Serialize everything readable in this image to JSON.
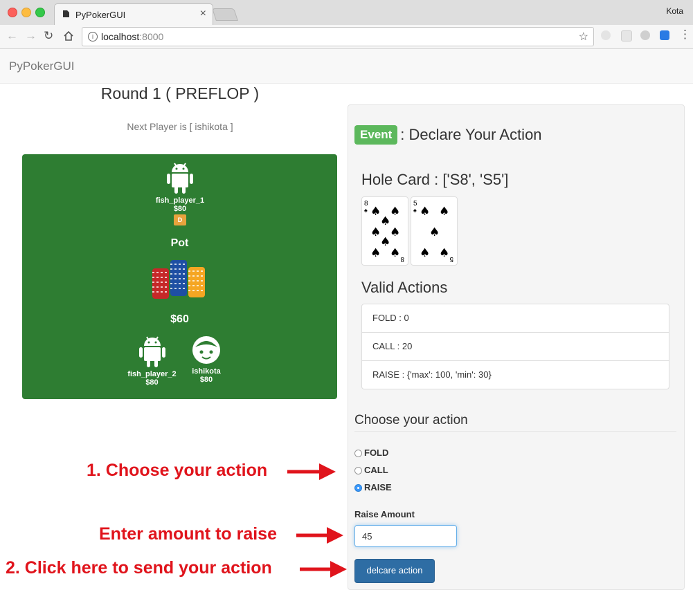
{
  "browser": {
    "tab_title": "PyPokerGUI",
    "profile_name": "Kota",
    "url_host": "localhost",
    "url_port": ":8000"
  },
  "navbar": {
    "brand": "PyPokerGUI"
  },
  "game": {
    "round_title": "Round 1 ( PREFLOP )",
    "next_player": "Next Player is [ ishikota ]",
    "players": [
      {
        "name": "fish_player_1",
        "stack": "$80",
        "dealer_badge": "D",
        "avatar_icon": "android-icon"
      },
      {
        "name": "fish_player_2",
        "stack": "$80",
        "avatar_icon": "android-icon"
      },
      {
        "name": "ishikota",
        "stack": "$80",
        "avatar_icon": "face-icon"
      }
    ],
    "pot_label": "Pot",
    "pot_amount": "$60",
    "table_color": "#2e7d32"
  },
  "panel": {
    "event_badge": "Event",
    "event_title": ": Declare Your Action",
    "hole_card_title": "Hole Card : ['S8', 'S5']",
    "cards": [
      {
        "rank": "8",
        "suit": "♠"
      },
      {
        "rank": "5",
        "suit": "♠"
      }
    ],
    "valid_actions_title": "Valid Actions",
    "valid_actions": [
      "FOLD : 0",
      "CALL : 20",
      "RAISE : {'max': 100, 'min': 30}"
    ],
    "choose_title": "Choose your action",
    "options": [
      {
        "label": "FOLD",
        "checked": false
      },
      {
        "label": "CALL",
        "checked": false
      },
      {
        "label": "RAISE",
        "checked": true
      }
    ],
    "raise_label": "Raise Amount",
    "raise_value": "45",
    "submit_label": "delcare action"
  },
  "annotations": {
    "step1": "1. Choose your action",
    "enter_amount": "Enter amount to raise",
    "step2": "2. Click here to send your action",
    "color": "#e0141c"
  }
}
